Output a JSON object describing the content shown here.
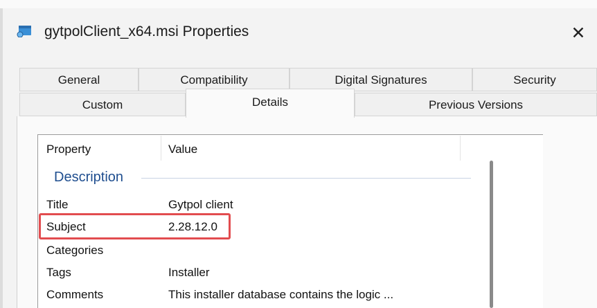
{
  "window": {
    "title": "gytpolClient_x64.msi Properties",
    "close_glyph": "✕",
    "icon": "msi-installer-icon"
  },
  "tabs_row1": [
    {
      "label": "General"
    },
    {
      "label": "Compatibility"
    },
    {
      "label": "Digital Signatures"
    },
    {
      "label": "Security"
    }
  ],
  "tabs_row2": [
    {
      "label": "Custom"
    },
    {
      "label": "Details",
      "selected": true
    },
    {
      "label": "Previous Versions"
    }
  ],
  "list": {
    "columns": {
      "property": "Property",
      "value": "Value"
    },
    "group": "Description",
    "rows": [
      {
        "property": "Title",
        "value": "Gytpol client"
      },
      {
        "property": "Subject",
        "value": "2.28.12.0",
        "highlighted": true
      },
      {
        "property": "Categories",
        "value": ""
      },
      {
        "property": "Tags",
        "value": "Installer"
      },
      {
        "property": "Comments",
        "value": "This installer database contains the logic ..."
      }
    ]
  },
  "colors": {
    "highlight": "#e24c4f",
    "group_text": "#1f4e8f"
  }
}
